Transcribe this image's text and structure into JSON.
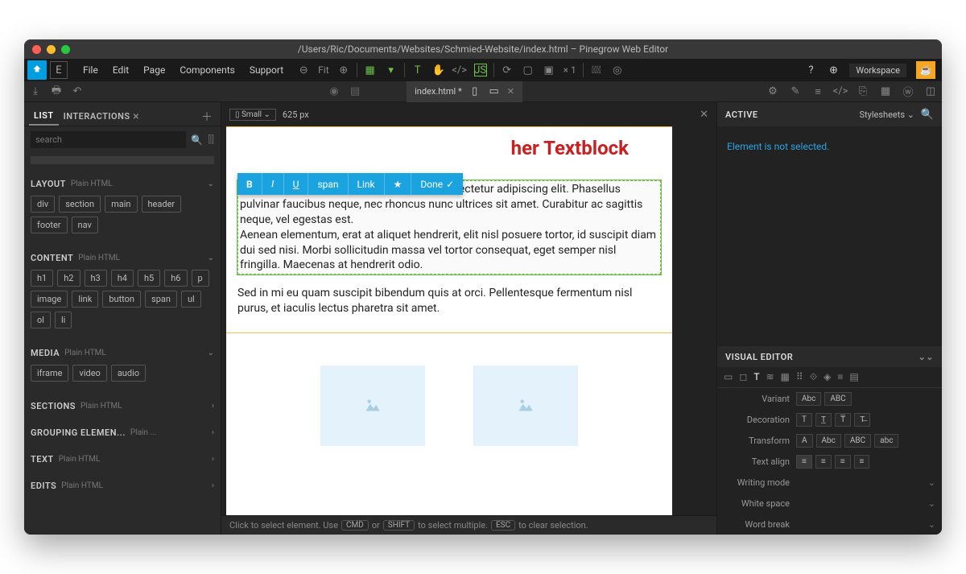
{
  "window": {
    "title": "/Users/Ric/Documents/Websites/Schmied-Website/index.html – Pinegrow Web Editor"
  },
  "menu": {
    "file": "File",
    "edit": "Edit",
    "page": "Page",
    "components": "Components",
    "support": "Support",
    "fit": "Fit",
    "scale": "× 1",
    "workspace": "Workspace"
  },
  "tab": {
    "name": "index.html *"
  },
  "viewport": {
    "size": "Small",
    "px": "625 px"
  },
  "sidebar": {
    "tabs": {
      "list": "LIST",
      "interactions": "INTERACTIONS"
    },
    "search_placeholder": "search",
    "sections": {
      "layout": {
        "title": "LAYOUT",
        "hint": "Plain HTML",
        "chips": [
          "div",
          "section",
          "main",
          "header",
          "footer",
          "nav"
        ]
      },
      "content": {
        "title": "CONTENT",
        "hint": "Plain HTML",
        "chips": [
          "h1",
          "h2",
          "h3",
          "h4",
          "h5",
          "h6",
          "p",
          "image",
          "link",
          "button",
          "span",
          "ul",
          "ol",
          "li"
        ]
      },
      "media": {
        "title": "MEDIA",
        "hint": "Plain HTML",
        "chips": [
          "iframe",
          "video",
          "audio"
        ]
      },
      "sections": {
        "title": "SECTIONS",
        "hint": "Plain HTML"
      },
      "grouping": {
        "title": "GROUPING ELEMEN...",
        "hint": "Plain ..."
      },
      "text": {
        "title": "TEXT",
        "hint": "Plain HTML"
      },
      "edits": {
        "title": "EDITS",
        "hint": "Plain HTML"
      }
    }
  },
  "editor_toolbar": {
    "b": "B",
    "i": "I",
    "u": "U",
    "span": "span",
    "link": "Link",
    "star": "★",
    "done": "Done"
  },
  "page": {
    "heading_visible": "her Textblock",
    "p1": "ParagraphLorem ipsum dolor sit amet, consectetur adipiscing elit. Phasellus pulvinar faucibus neque, nec rhoncus nunc ultrices sit amet. Curabitur ac sagittis neque, vel egestas est.\nAenean elementum, erat at aliquet hendrerit, elit nisl posuere tortor, id suscipit diam dui sed nisi. Morbi sollicitudin massa vel tortor consequat, eget semper nisl fringilla. Maecenas at hendrerit odio.",
    "p2": "Sed in mi eu quam suscipit bibendum quis at orci. Pellentesque fermentum nisl purus, et iaculis lectus pharetra sit amet."
  },
  "status": {
    "pre": "Click to select element. Use",
    "cmd": "CMD",
    "or": "or",
    "shift": "SHIFT",
    "mid": "to select multiple.",
    "esc": "ESC",
    "post": "to clear selection."
  },
  "rightpanel": {
    "active": "ACTIVE",
    "stylesheets": "Stylesheets",
    "msg": "Element is not selected.",
    "visual_editor": "VISUAL EDITOR",
    "rows": {
      "variant": {
        "label": "Variant",
        "opts": [
          "Abc",
          "ABC"
        ]
      },
      "decoration": {
        "label": "Decoration",
        "opts": [
          "T",
          "T̲",
          "T̅",
          "T̶"
        ]
      },
      "transform": {
        "label": "Transform",
        "opts": [
          "A",
          "Abc",
          "ABC",
          "abc"
        ]
      },
      "align": {
        "label": "Text align"
      },
      "writing": {
        "label": "Writing mode"
      },
      "whitespace": {
        "label": "White space"
      },
      "wordbreak": {
        "label": "Word break"
      }
    }
  }
}
